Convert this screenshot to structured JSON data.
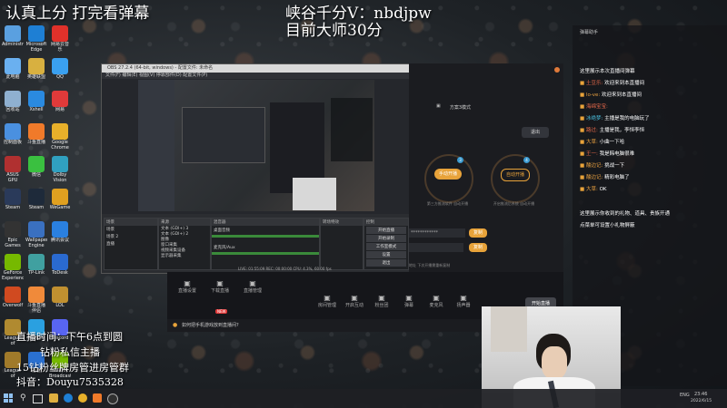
{
  "overlay": {
    "top_left": "认真上分 打完看弹幕",
    "top_right_1": "峡谷千分V：nbdjpw",
    "top_right_2": "目前大师30分",
    "bottom_left": [
      "直播时间：下午6点到圆",
      "钻粉私信主播",
      "15钻粉丝牌房管进房管群",
      "抖音：Douyu7535328"
    ]
  },
  "desktop_icons": [
    {
      "label": "Administr.",
      "color": "#5aa0e0"
    },
    {
      "label": "Microsoft Edge",
      "color": "#1e7fd4"
    },
    {
      "label": "网易云音乐",
      "color": "#e0312a"
    },
    {
      "label": "此电脑",
      "color": "#6ab0f0"
    },
    {
      "label": "英雄联盟",
      "color": "#d8b040"
    },
    {
      "label": "QQ",
      "color": "#3aa0f0"
    },
    {
      "label": "回收站",
      "color": "#8fb0d0"
    },
    {
      "label": "Xshell",
      "color": "#2a8ae0"
    },
    {
      "label": "网易",
      "color": "#e03a3a"
    },
    {
      "label": "控制面板",
      "color": "#4a90e0"
    },
    {
      "label": "斗鱼直播",
      "color": "#f07a2a"
    },
    {
      "label": "Google Chrome",
      "color": "#e8b02a"
    },
    {
      "label": "ASUS GPU Tweak",
      "color": "#b03030"
    },
    {
      "label": "微信",
      "color": "#3ac040"
    },
    {
      "label": "Dolby Vision",
      "color": "#30a0c0"
    },
    {
      "label": "Steam",
      "color": "#2a3a5a"
    },
    {
      "label": "Steam",
      "color": "#1e2a3a"
    },
    {
      "label": "WeGame",
      "color": "#e0a020"
    },
    {
      "label": "Epic Games",
      "color": "#333"
    },
    {
      "label": "Wallpaper Engine",
      "color": "#3a70c0"
    },
    {
      "label": "腾讯会议",
      "color": "#2a80e0"
    },
    {
      "label": "GeForce Experience",
      "color": "#76b900"
    },
    {
      "label": "TP-Link",
      "color": "#40a0a0"
    },
    {
      "label": "ToDesk",
      "color": "#2a6ad0"
    },
    {
      "label": "Overwolf",
      "color": "#d04a20"
    },
    {
      "label": "斗鱼直播伴侣",
      "color": "#f08a3a"
    },
    {
      "label": "LOL",
      "color": "#c09030"
    },
    {
      "label": "League of Legends",
      "color": "#b08a30"
    },
    {
      "label": "腾讯QQ",
      "color": "#2aa0e0"
    },
    {
      "label": "Discord",
      "color": "#5865f2"
    },
    {
      "label": "League of Legends",
      "color": "#a07a2a"
    },
    {
      "label": "迅雷",
      "color": "#2a70d0"
    },
    {
      "label": "NVIDIA Broadcast",
      "color": "#76b900"
    }
  ],
  "obs": {
    "title": "OBS 27.2.4 (64-bit, windows) - 配置文件: 未命名",
    "menu": "文件(F)  编辑(E)  视图(V)  停靠部件(D)  配置文件(P)",
    "dock_scenes": "场景",
    "dock_sources": "来源",
    "dock_mixer": "混音器",
    "dock_transitions": "转场特效",
    "dock_controls": "控制",
    "scene_items": [
      "场景",
      "场景 2",
      "直播"
    ],
    "source_items": [
      "文本 (GDI+) 3",
      "文本 (GDI+) 2",
      "图像",
      "窗口采集",
      "视频采集设备",
      "显示器采集"
    ],
    "mixer_items": [
      "桌面音频",
      "麦克风/Aux"
    ],
    "controls": [
      "开始直播",
      "开始录制",
      "工作室模式",
      "设置",
      "退出"
    ],
    "status": "LIVE: 01:55:09   REC: 00:00:00   CPU: 4.3%, 60.00 fps"
  },
  "app": {
    "mode_label": "方案3模式",
    "mode_btn": "退出",
    "circle1": "手动开播",
    "circle1_sub": "第三方推流软件 自动开播",
    "circle2": "自动开播",
    "circle2_sub": "开启推流后系统 自动开播",
    "stream_key": "************",
    "copy1": "复制",
    "copy2": "复制",
    "note": "地址  下次开播需重新复制",
    "toolbar": [
      "直播设置",
      "下载直播",
      "直播管理"
    ],
    "toolbar2": [
      "房间管理",
      "开启互动",
      "粉丝团",
      "弹幕",
      "麦克风",
      "扬声器"
    ],
    "start_btn": "开始直播",
    "tip": "如何把手机游戏放到直播间?",
    "tip_badge": "NEW"
  },
  "chat": {
    "header": "弹幕助手",
    "system": "这里展示本次直播间弹幕",
    "lines": [
      {
        "name": "土豆乐",
        "text": "欢迎来到本直播间",
        "nc": "#e86a4a"
      },
      {
        "name": "lo-ve",
        "text": "欢迎来到本直播间",
        "nc": "#e8a040"
      },
      {
        "name": "海绵宝宝",
        "text": "",
        "nc": "#e86a4a"
      },
      {
        "name": "冰绝梦",
        "text": "主播是我的电脑玩了",
        "nc": "#4ac0e0"
      },
      {
        "name": "路过",
        "text": "主播是我，李恒李恒",
        "nc": "#e86a4a"
      },
      {
        "name": "大草",
        "text": "小曲一下哈",
        "nc": "#e8a040"
      },
      {
        "name": "王一",
        "text": "我是韩电脑很难",
        "nc": "#e86a4a"
      },
      {
        "name": "酸边记",
        "text": "挑战一下",
        "nc": "#e8a040"
      },
      {
        "name": "酸边记",
        "text": "精彩电脑了",
        "nc": "#e8a040"
      },
      {
        "name": "大草",
        "text": "OK",
        "nc": "#e8a040"
      }
    ],
    "notice": "这里展示你收到的礼物、道具、贵族开通",
    "notice2": "点菜单可设置小礼物屏蔽"
  },
  "taskbar": {
    "lang": "ENG",
    "time": "23:46",
    "date": "2022/6/15"
  }
}
